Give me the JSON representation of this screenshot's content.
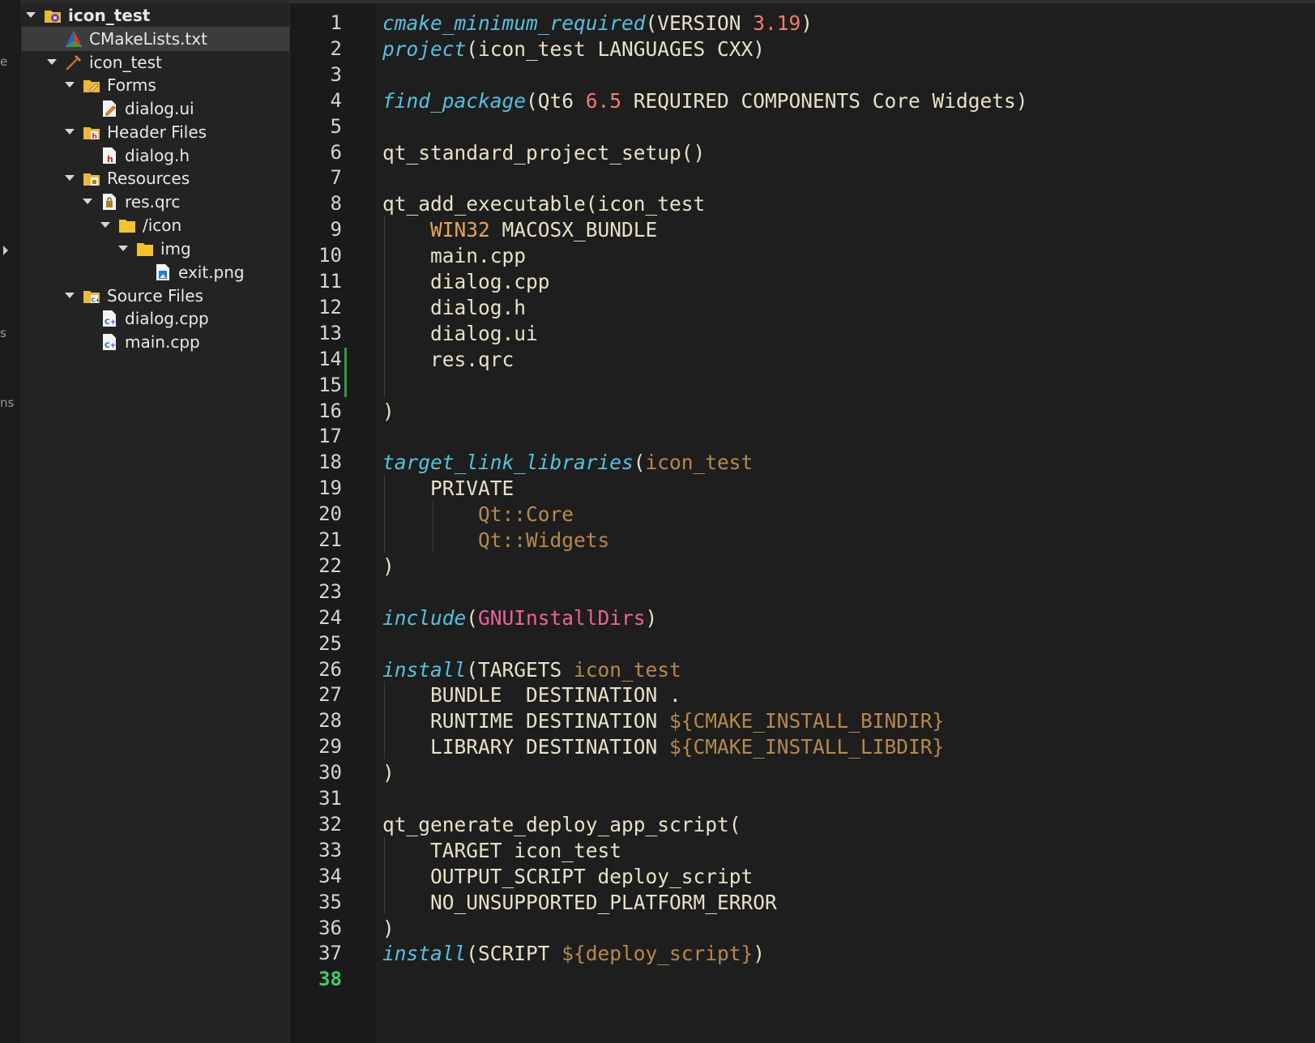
{
  "modebar": {
    "fragments": [
      "e",
      "s",
      "ns"
    ]
  },
  "tree": {
    "items": [
      {
        "label": "icon_test",
        "icon": "cmake-project-icon",
        "bold": true,
        "expanded": true
      },
      {
        "label": "CMakeLists.txt",
        "icon": "cmake-file-icon",
        "selected": true
      },
      {
        "label": "icon_test",
        "icon": "hammer-icon",
        "expanded": true
      },
      {
        "label": "Forms",
        "icon": "forms-folder-icon",
        "expanded": true
      },
      {
        "label": "dialog.ui",
        "icon": "ui-file-icon"
      },
      {
        "label": "Header Files",
        "icon": "header-folder-icon",
        "expanded": true
      },
      {
        "label": "dialog.h",
        "icon": "header-file-icon"
      },
      {
        "label": "Resources",
        "icon": "resources-folder-icon",
        "expanded": true
      },
      {
        "label": "res.qrc",
        "icon": "qrc-file-icon",
        "expanded": true
      },
      {
        "label": "/icon",
        "icon": "folder-icon",
        "expanded": true
      },
      {
        "label": "img",
        "icon": "folder-icon",
        "expanded": true
      },
      {
        "label": "exit.png",
        "icon": "image-file-icon"
      },
      {
        "label": "Source Files",
        "icon": "source-folder-icon",
        "expanded": true
      },
      {
        "label": "dialog.cpp",
        "icon": "cpp-file-icon"
      },
      {
        "label": "main.cpp",
        "icon": "cpp-file-icon"
      }
    ]
  },
  "editor": {
    "current_line": 38,
    "lines": [
      [
        [
          "fn",
          "cmake_minimum_required"
        ],
        [
          "p",
          "(VERSION "
        ],
        [
          "num",
          "3.19"
        ],
        [
          "p",
          ")"
        ]
      ],
      [
        [
          "fn",
          "project"
        ],
        [
          "p",
          "(icon_test LANGUAGES CXX)"
        ]
      ],
      [],
      [
        [
          "fn",
          "find_package"
        ],
        [
          "p",
          "(Qt6 "
        ],
        [
          "num",
          "6.5"
        ],
        [
          "p",
          " REQUIRED COMPONENTS Core Widgets)"
        ]
      ],
      [],
      [
        [
          "p",
          "qt_standard_project_setup()"
        ]
      ],
      [],
      [
        [
          "p",
          "qt_add_executable(icon_test"
        ]
      ],
      [
        [
          "p",
          "    "
        ],
        [
          "kw",
          "WIN32"
        ],
        [
          "p",
          " MACOSX_BUNDLE"
        ]
      ],
      [
        [
          "p",
          "    main.cpp"
        ]
      ],
      [
        [
          "p",
          "    dialog.cpp"
        ]
      ],
      [
        [
          "p",
          "    dialog.h"
        ]
      ],
      [
        [
          "p",
          "    dialog.ui"
        ]
      ],
      [
        [
          "p",
          "    res.qrc"
        ]
      ],
      [],
      [
        [
          "p",
          ")"
        ]
      ],
      [],
      [
        [
          "fn",
          "target_link_libraries"
        ],
        [
          "p",
          "("
        ],
        [
          "arg",
          "icon_test"
        ]
      ],
      [
        [
          "p",
          "    PRIVATE"
        ]
      ],
      [
        [
          "p",
          "        "
        ],
        [
          "arg",
          "Qt::Core"
        ]
      ],
      [
        [
          "p",
          "        "
        ],
        [
          "arg",
          "Qt::Widgets"
        ]
      ],
      [
        [
          "p",
          ")"
        ]
      ],
      [],
      [
        [
          "fn",
          "include"
        ],
        [
          "p",
          "("
        ],
        [
          "mod",
          "GNUInstallDirs"
        ],
        [
          "p",
          ")"
        ]
      ],
      [],
      [
        [
          "fn",
          "install"
        ],
        [
          "p",
          "(TARGETS "
        ],
        [
          "arg",
          "icon_test"
        ]
      ],
      [
        [
          "p",
          "    BUNDLE  DESTINATION ."
        ]
      ],
      [
        [
          "p",
          "    RUNTIME DESTINATION "
        ],
        [
          "arg",
          "${CMAKE_INSTALL_BINDIR}"
        ]
      ],
      [
        [
          "p",
          "    LIBRARY DESTINATION "
        ],
        [
          "arg",
          "${CMAKE_INSTALL_LIBDIR}"
        ]
      ],
      [
        [
          "p",
          ")"
        ]
      ],
      [],
      [
        [
          "p",
          "qt_generate_deploy_app_script("
        ]
      ],
      [
        [
          "p",
          "    TARGET icon_test"
        ]
      ],
      [
        [
          "p",
          "    OUTPUT_SCRIPT deploy_script"
        ]
      ],
      [
        [
          "p",
          "    NO_UNSUPPORTED_PLATFORM_ERROR"
        ]
      ],
      [
        [
          "p",
          ")"
        ]
      ],
      [
        [
          "fn",
          "install"
        ],
        [
          "p",
          "(SCRIPT "
        ],
        [
          "arg",
          "${deploy_script}"
        ],
        [
          "p",
          ")"
        ]
      ],
      []
    ]
  }
}
